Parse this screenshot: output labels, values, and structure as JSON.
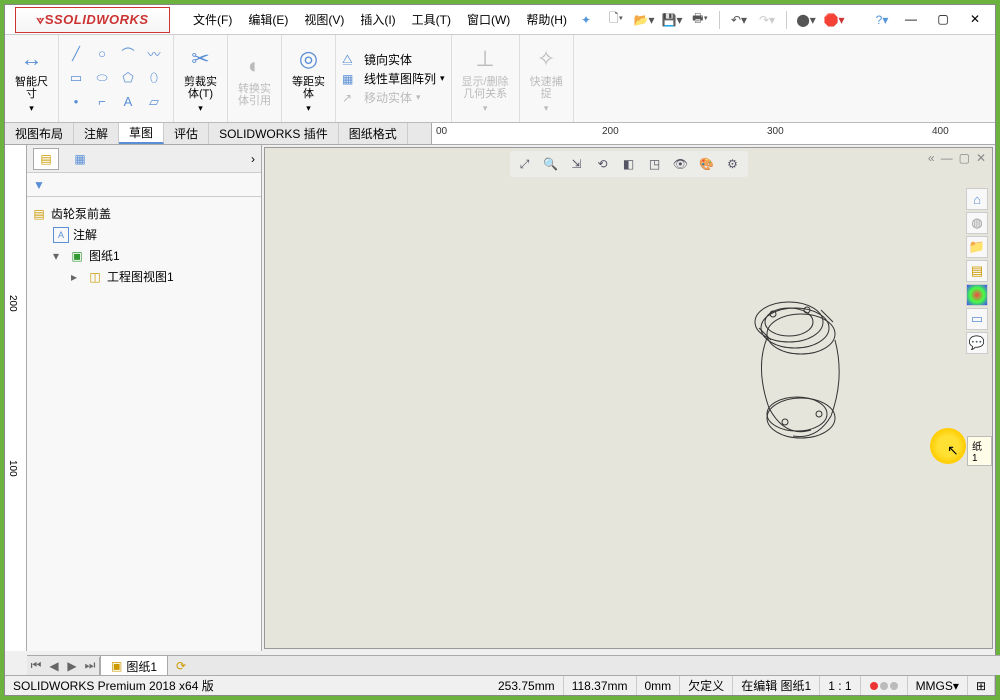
{
  "logo": "SOLIDWORKS",
  "menu": [
    "文件(F)",
    "编辑(E)",
    "视图(V)",
    "插入(I)",
    "工具(T)",
    "窗口(W)",
    "帮助(H)"
  ],
  "ribbon": {
    "smartdim": "智能尺\n寸",
    "trim": "剪裁实\n体(T)",
    "convert": "转换实\n体引用",
    "offset": "等距实\n体",
    "mirror": "镜向实体",
    "pattern": "线性草图阵列",
    "move": "移动实体",
    "showrel": "显示/删除\n几何关系",
    "quicksnap": "快速捕\n捉"
  },
  "tabs": [
    "视图布局",
    "注解",
    "草图",
    "评估",
    "SOLIDWORKS 插件",
    "图纸格式"
  ],
  "active_tab": 2,
  "ruler_h": [
    "00",
    "200",
    "300",
    "400"
  ],
  "ruler_v": [
    "200",
    "100"
  ],
  "tree": {
    "root": "齿轮泵前盖",
    "annotations": "注解",
    "sheet": "图纸1",
    "view": "工程图视图1"
  },
  "tooltip": "纸1",
  "sheet_tab": "图纸1",
  "status": {
    "version": "SOLIDWORKS Premium 2018 x64 版",
    "x": "253.75mm",
    "y": "118.37mm",
    "z": "0mm",
    "def": "欠定义",
    "editing": "在编辑 图纸1",
    "scale": "1 : 1",
    "units": "MMGS"
  }
}
